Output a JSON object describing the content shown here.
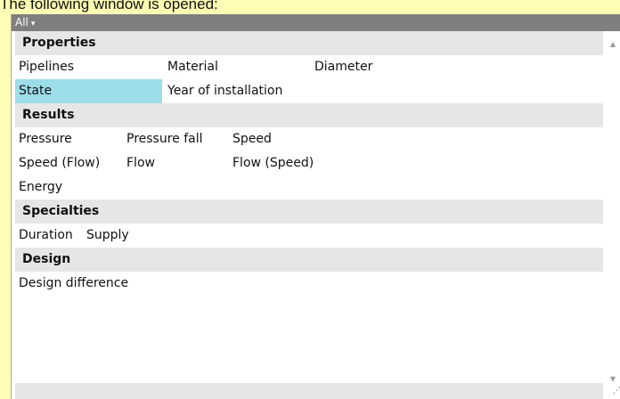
{
  "caption": "The following window is opened:",
  "filter": {
    "label": "All",
    "arrow": "▾"
  },
  "groups": {
    "properties": {
      "title": "Properties",
      "items": [
        "Pipelines",
        "Material",
        "Diameter",
        "State",
        "Year of installation"
      ]
    },
    "results": {
      "title": "Results",
      "items": [
        "Pressure",
        "Pressure fall",
        "Speed",
        "Speed (Flow)",
        "Flow",
        "Flow (Speed)",
        "Energy"
      ]
    },
    "specialties": {
      "title": "Specialties",
      "items": [
        "Duration",
        "Supply"
      ]
    },
    "design": {
      "title": "Design",
      "items": [
        "Design difference"
      ]
    }
  },
  "selected_item": "State",
  "colors": {
    "caption_background": "#fdfdb4",
    "filter_bar": "#7f7f7f",
    "group_header": "#e6e6e6",
    "selection": "#9cdde9"
  },
  "icons": {
    "scroll_up": "▲",
    "scroll_down": "▼",
    "grip": "⋰"
  }
}
